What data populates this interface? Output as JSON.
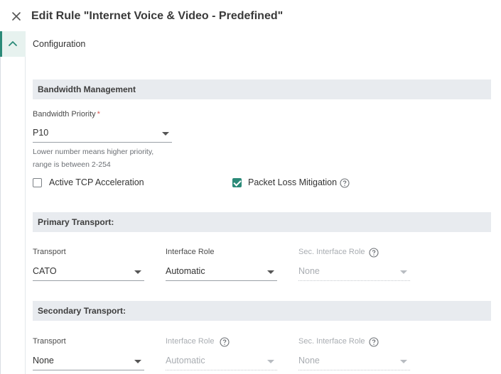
{
  "header": {
    "title": "Edit Rule \"Internet Voice & Video - Predefined\"",
    "close_icon": "close-icon"
  },
  "section": {
    "title": "Configuration",
    "toggle_icon": "chevron-up-icon"
  },
  "bandwidth": {
    "heading": "Bandwidth Management",
    "priority_label": "Bandwidth Priority",
    "required_mark": "*",
    "priority_value": "P10",
    "help_line1": "Lower number means higher priority,",
    "help_line2": "range is between 2-254",
    "tcp_accel_label": "Active TCP Acceleration",
    "tcp_accel_checked": false,
    "packet_loss_label": "Packet Loss Mitigation",
    "packet_loss_checked": true
  },
  "primary": {
    "heading": "Primary Transport:",
    "transport_label": "Transport",
    "transport_value": "CATO",
    "role_label": "Interface Role",
    "role_value": "Automatic",
    "sec_role_label": "Sec. Interface Role",
    "sec_role_value": "None"
  },
  "secondary": {
    "heading": "Secondary Transport:",
    "transport_label": "Transport",
    "transport_value": "None",
    "role_label": "Interface Role",
    "role_value": "Automatic",
    "sec_role_label": "Sec. Interface Role",
    "sec_role_value": "None"
  },
  "colors": {
    "accent": "#2b8a78",
    "band_bg": "#e8ebef",
    "required": "#d9534f"
  }
}
